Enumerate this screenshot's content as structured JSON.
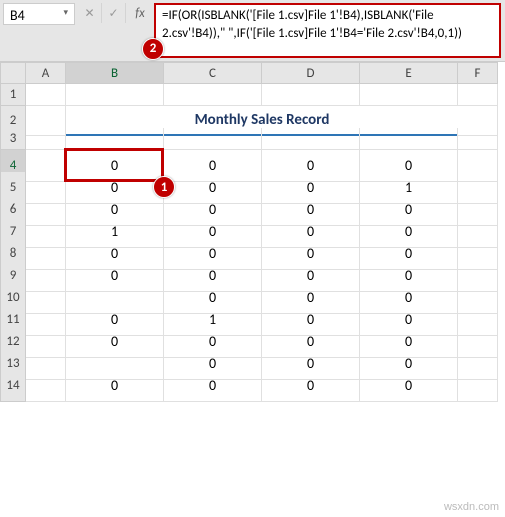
{
  "name_box": "B4",
  "formula": "=IF(OR(ISBLANK('[File 1.csv]File 1'!B4),ISBLANK('File 2.csv'!B4)),\"  \",IF('[File 1.csv]File 1'!B4='File 2.csv'!B4,0,1))",
  "callouts": {
    "formula": "2",
    "cell": "1"
  },
  "title": "Monthly Sales Record",
  "columns": [
    "A",
    "B",
    "C",
    "D",
    "E",
    "F"
  ],
  "rows": [
    "1",
    "2",
    "3",
    "4",
    "5",
    "6",
    "7",
    "8",
    "9",
    "10",
    "11",
    "12",
    "13",
    "14"
  ],
  "active_cell": {
    "row": 4,
    "col": "B"
  },
  "chart_data": {
    "type": "table",
    "title": "Monthly Sales Record",
    "columns": [
      "B",
      "C",
      "D",
      "E"
    ],
    "rows": [
      [
        0,
        0,
        0,
        0
      ],
      [
        0,
        0,
        0,
        1
      ],
      [
        0,
        0,
        0,
        0
      ],
      [
        1,
        0,
        0,
        0
      ],
      [
        0,
        0,
        0,
        0
      ],
      [
        0,
        0,
        0,
        0
      ],
      [
        null,
        0,
        0,
        0
      ],
      [
        0,
        1,
        0,
        0
      ],
      [
        0,
        0,
        0,
        0
      ],
      [
        null,
        0,
        0,
        0
      ],
      [
        0,
        0,
        0,
        0
      ]
    ]
  },
  "watermark": "wsxdn.com"
}
